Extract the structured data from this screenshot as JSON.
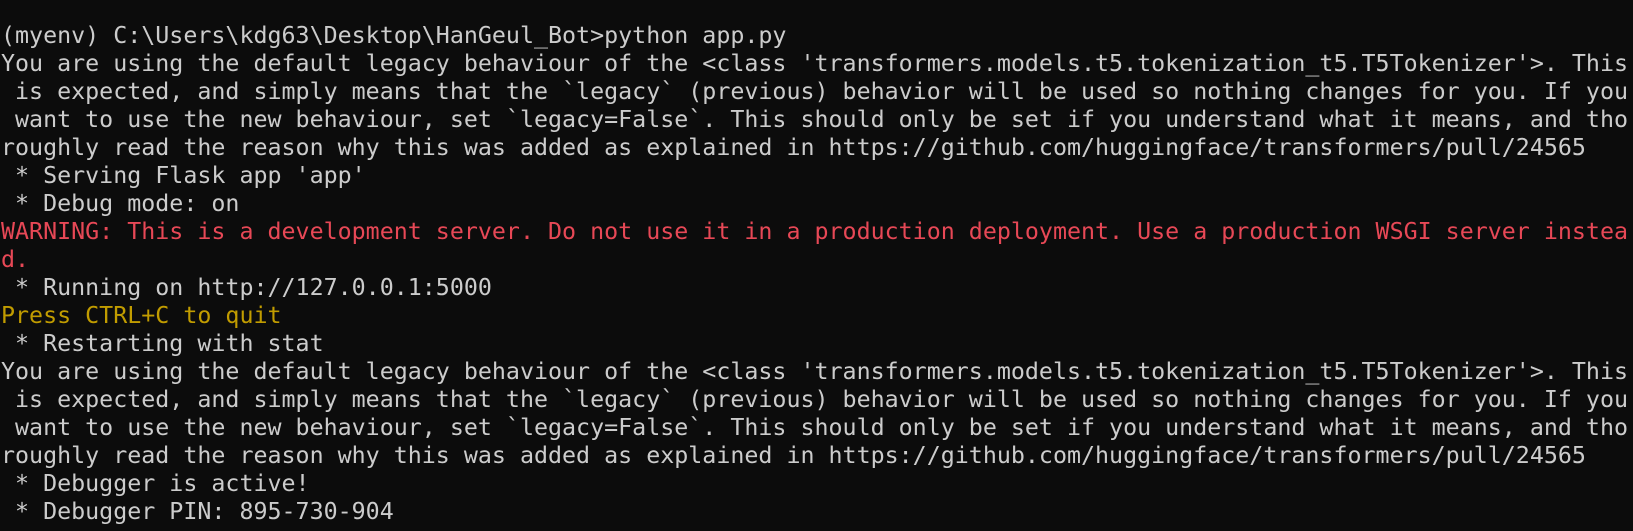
{
  "terminal": {
    "background": "#0c0c0c",
    "colors": {
      "default": "#cccccc",
      "red": "#e74856",
      "yellow": "#c19c00"
    },
    "lines": [
      {
        "text": "(myenv) C:\\Users\\kdg63\\Desktop\\HanGeul_Bot>python app.py",
        "color": "default"
      },
      {
        "text": "You are using the default legacy behaviour of the <class 'transformers.models.t5.tokenization_t5.T5Tokenizer'>. This",
        "color": "default"
      },
      {
        "text": " is expected, and simply means that the `legacy` (previous) behavior will be used so nothing changes for you. If you",
        "color": "default"
      },
      {
        "text": " want to use the new behaviour, set `legacy=False`. This should only be set if you understand what it means, and tho",
        "color": "default"
      },
      {
        "text": "roughly read the reason why this was added as explained in https://github.com/huggingface/transformers/pull/24565",
        "color": "default"
      },
      {
        "text": " * Serving Flask app 'app'",
        "color": "default"
      },
      {
        "text": " * Debug mode: on",
        "color": "default"
      },
      {
        "text": "WARNING: This is a development server. Do not use it in a production deployment. Use a production WSGI server instea",
        "color": "red"
      },
      {
        "text": "d.",
        "color": "red"
      },
      {
        "text": " * Running on http://127.0.0.1:5000",
        "color": "default"
      },
      {
        "text": "Press CTRL+C to quit",
        "color": "yellow"
      },
      {
        "text": " * Restarting with stat",
        "color": "default"
      },
      {
        "text": "You are using the default legacy behaviour of the <class 'transformers.models.t5.tokenization_t5.T5Tokenizer'>. This",
        "color": "default"
      },
      {
        "text": " is expected, and simply means that the `legacy` (previous) behavior will be used so nothing changes for you. If you",
        "color": "default"
      },
      {
        "text": " want to use the new behaviour, set `legacy=False`. This should only be set if you understand what it means, and tho",
        "color": "default"
      },
      {
        "text": "roughly read the reason why this was added as explained in https://github.com/huggingface/transformers/pull/24565",
        "color": "default"
      },
      {
        "text": " * Debugger is active!",
        "color": "default"
      },
      {
        "text": " * Debugger PIN: 895-730-904",
        "color": "default"
      }
    ]
  }
}
